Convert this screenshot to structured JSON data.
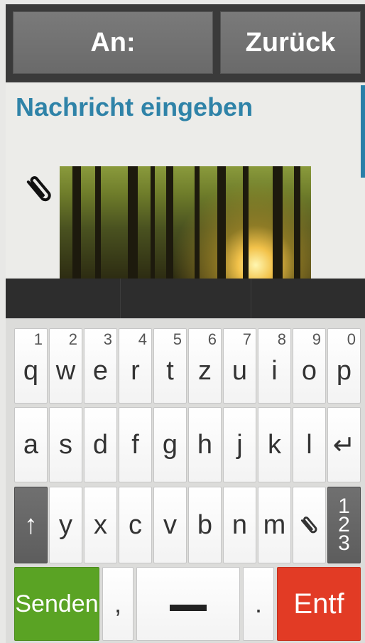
{
  "header": {
    "to_label": "An:",
    "back_label": "Zurück"
  },
  "compose": {
    "placeholder": "Nachricht eingeben",
    "attachment_image": "forest-sunlight-photo"
  },
  "keyboard": {
    "row1": [
      {
        "num": "1",
        "letter": "q"
      },
      {
        "num": "2",
        "letter": "w"
      },
      {
        "num": "3",
        "letter": "e"
      },
      {
        "num": "4",
        "letter": "r"
      },
      {
        "num": "5",
        "letter": "t"
      },
      {
        "num": "6",
        "letter": "z"
      },
      {
        "num": "7",
        "letter": "u"
      },
      {
        "num": "8",
        "letter": "i"
      },
      {
        "num": "9",
        "letter": "o"
      },
      {
        "num": "0",
        "letter": "p"
      }
    ],
    "row2": [
      "a",
      "s",
      "d",
      "f",
      "g",
      "h",
      "j",
      "k",
      "l"
    ],
    "enter_icon": "↵",
    "row3": [
      "y",
      "x",
      "c",
      "v",
      "b",
      "n",
      "m"
    ],
    "shift_icon": "↑",
    "numbers_toggle": [
      "1",
      "2",
      "3"
    ],
    "send_label": "Senden",
    "comma_label": ",",
    "period_label": ".",
    "delete_label": "Entf"
  },
  "colors": {
    "send": "#5aa324",
    "delete": "#e23b25",
    "accent": "#2f83a8"
  }
}
